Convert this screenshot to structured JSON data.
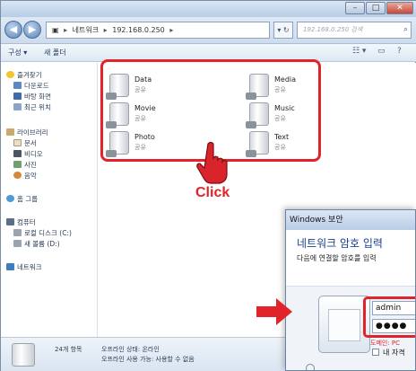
{
  "explorer": {
    "breadcrumb": [
      "네트워크",
      "192.168.0.250"
    ],
    "search_placeholder": "192.168.0.250 검색",
    "toolbar": {
      "organize": "구성 ▾",
      "new_folder": "새 폴더"
    },
    "nav": {
      "favorites": "즐겨찾기",
      "downloads": "다운로드",
      "desktop": "바탕 화면",
      "recent": "최근 위치",
      "libraries": "라이브러리",
      "documents": "문서",
      "videos": "비디오",
      "pictures": "사진",
      "music": "음악",
      "homegroup": "홈 그룹",
      "computer": "컴퓨터",
      "local_disk": "로컬 디스크 (C:)",
      "new_volume": "새 볼륨 (D:)",
      "network": "네트워크"
    },
    "shares": [
      {
        "name": "Data",
        "sub": "공유"
      },
      {
        "name": "Media",
        "sub": "공유"
      },
      {
        "name": "Movie",
        "sub": "공유"
      },
      {
        "name": "Music",
        "sub": "공유"
      },
      {
        "name": "Photo",
        "sub": "공유"
      },
      {
        "name": "Text",
        "sub": "공유"
      }
    ],
    "status": {
      "count": "24개 항목",
      "offline_status": "오프라인 상태: 온라인",
      "offline_avail": "오프라인 사용 가능: 사용할 수 없음"
    }
  },
  "annotation": {
    "click_label": "Click"
  },
  "dialog": {
    "title": "Windows 보안",
    "heading": "네트워크 암호 입력",
    "sub": "다음에 연결할 암호를 입력",
    "username": "admin",
    "password_mask": "●●●●",
    "domain": "도메인: PC",
    "remember": "내 자격"
  },
  "colors": {
    "highlight_red": "#e0242a",
    "dialog_heading_blue": "#1b3f8f"
  }
}
